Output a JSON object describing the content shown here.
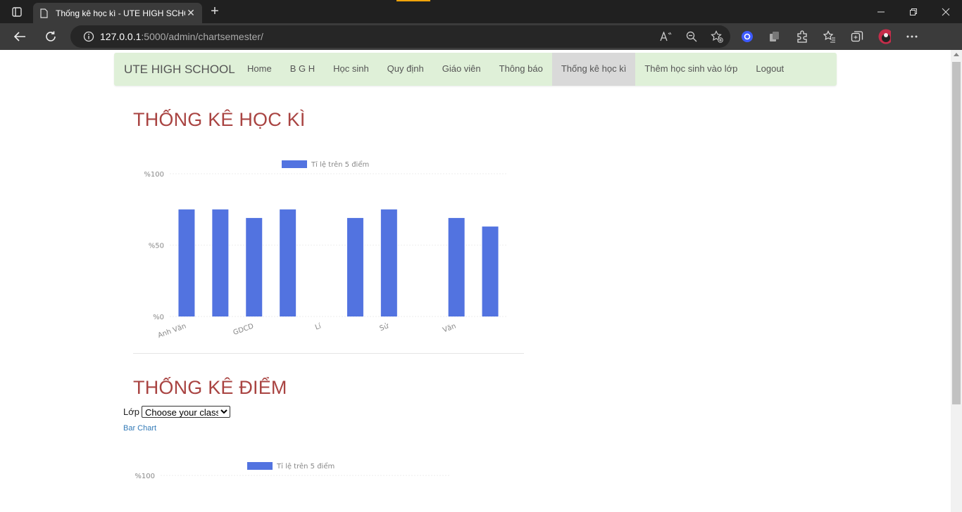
{
  "browser": {
    "tab_title": "Thống kê học kì - UTE HIGH SCHOOL",
    "url_host": "127.0.0.1",
    "url_path": ":5000/admin/chartsemester/"
  },
  "navbar": {
    "brand": "UTE HIGH SCHOOL",
    "items": [
      {
        "label": "Home"
      },
      {
        "label": "B G H"
      },
      {
        "label": "Học sinh"
      },
      {
        "label": "Quy định"
      },
      {
        "label": "Giáo viên"
      },
      {
        "label": "Thông báo"
      },
      {
        "label": "Thống kê học kì",
        "active": true
      },
      {
        "label": "Thêm học sinh vào lớp"
      },
      {
        "label": "Logout"
      }
    ]
  },
  "semester_section": {
    "title": "THỐNG KÊ HỌC KÌ"
  },
  "score_section": {
    "title": "THỐNG KÊ ĐIỂM",
    "class_label": "Lớp",
    "class_select_value": "Choose your class",
    "chart_link": "Bar Chart"
  },
  "colors": {
    "bar": "#5273e0",
    "section_title": "#a94442",
    "navbar_bg": "#dff0d8"
  },
  "chart_data": [
    {
      "type": "bar",
      "legend": [
        "Tỉ lệ trên 5 điểm"
      ],
      "legend_position": "top",
      "tick_labels_y": [
        "%100",
        "%50",
        "%0"
      ],
      "categories": [
        "Anh Văn",
        "",
        "GDCD",
        "",
        "Lí",
        "",
        "Sử",
        "",
        "Văn",
        ""
      ],
      "series": [
        {
          "name": "Tỉ lệ trên 5 điểm",
          "values": [
            75,
            75,
            69,
            75,
            0,
            69,
            75,
            0,
            69,
            63
          ]
        }
      ],
      "ylim": [
        0,
        100
      ],
      "grid": true
    },
    {
      "type": "bar",
      "legend": [
        "Tỉ lệ trên 5 điểm"
      ],
      "legend_position": "top",
      "tick_labels_y": [
        "%100"
      ],
      "ylim": [
        0,
        100
      ],
      "grid": true
    }
  ]
}
